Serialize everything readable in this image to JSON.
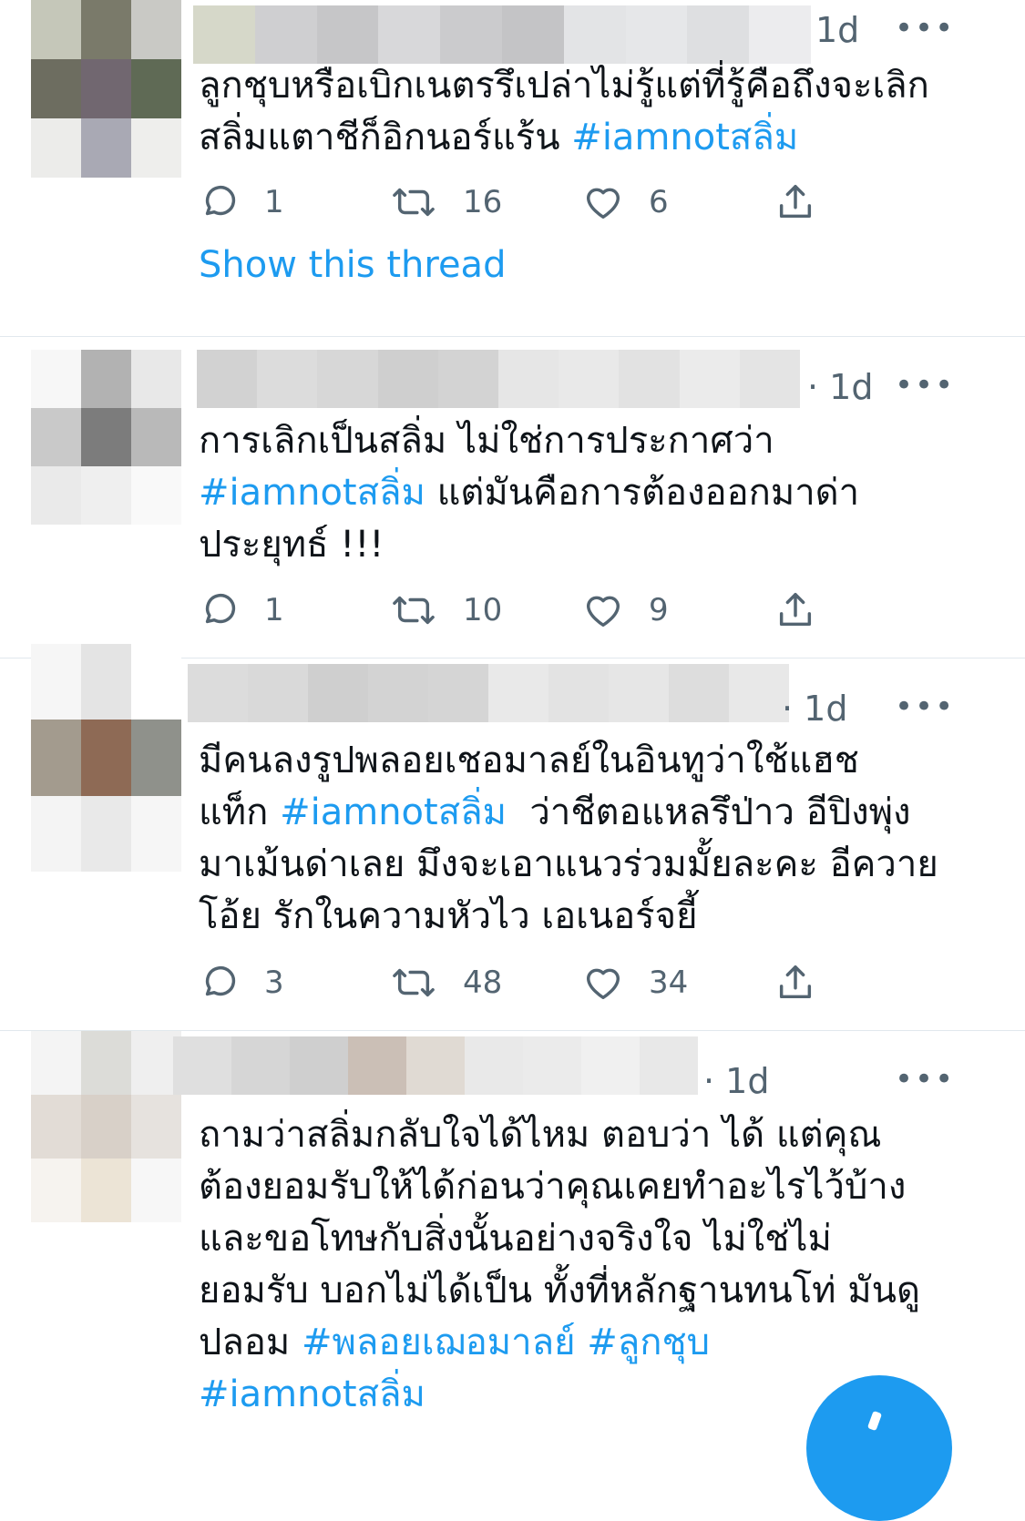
{
  "tweets": [
    {
      "time": "1d",
      "lines": [
        [
          {
            "t": "ลูกชุบหรือเบิกเนตรรึเปล่าไม่รู้แต่ที่รู้คือถึงจะเลิก"
          }
        ],
        [
          {
            "t": "สลิ่มแตาชีก็อิกนอร์แร้น "
          },
          {
            "t": "#iamnotสลิ่ม",
            "hashtag": true
          }
        ]
      ],
      "replies": "1",
      "retweets": "16",
      "likes": "6",
      "show_thread": "Show this thread"
    },
    {
      "time": "· 1d",
      "lines": [
        [
          {
            "t": "การเลิกเป็นสลิ่ม ไม่ใช่การประกาศว่า"
          }
        ],
        [
          {
            "t": "#iamnotสลิ่ม",
            "hashtag": true
          },
          {
            "t": " แต่มันคือการต้องออกมาด่า"
          }
        ],
        [
          {
            "t": "ประยุทธ์ !!!"
          }
        ]
      ],
      "replies": "1",
      "retweets": "10",
      "likes": "9"
    },
    {
      "time": "· 1d",
      "lines": [
        [
          {
            "t": "มีคนลงรูปพลอยเชอมาลย์ในอินทูว่าใช้แฮช"
          }
        ],
        [
          {
            "t": "แท็ก "
          },
          {
            "t": "#iamnotสลิ่ม",
            "hashtag": true
          },
          {
            "t": "  ว่าชีตอแหลรึป่าว อีปิงพุ่ง"
          }
        ],
        [
          {
            "t": "มาเม้นด่าเลย มึงจะเอาแนวร่วมมั้ยละคะ อีควาย"
          }
        ],
        [
          {
            "t": "โอ้ย รักในความหัวไว เอเนอร์จยี้"
          }
        ]
      ],
      "replies": "3",
      "retweets": "48",
      "likes": "34"
    },
    {
      "time": "· 1d",
      "lines": [
        [
          {
            "t": "ถามว่าสลิ่มกลับใจได้ไหม ตอบว่า ได้ แต่คุณ"
          }
        ],
        [
          {
            "t": "ต้องยอมรับให้ได้ก่อนว่าคุณเคยทำอะไรไว้บ้าง"
          }
        ],
        [
          {
            "t": "และขอโทษกับสิ่งนั้นอย่างจริงใจ ไม่ใช่ไม่"
          }
        ],
        [
          {
            "t": "ยอมรับ บอกไม่ได้เป็น ทั้งที่หลักฐานทนโท่ มันดู"
          }
        ],
        [
          {
            "t": "ปลอม "
          },
          {
            "t": "#พลอยเฌอมาลย์",
            "hashtag": true
          },
          {
            "t": " "
          },
          {
            "t": "#ลูกชุบ",
            "hashtag": true
          }
        ],
        [
          {
            "t": "#iamnotสลิ่ม",
            "hashtag": true
          }
        ]
      ]
    }
  ],
  "more_icon": "more-horizontal-icon",
  "colors": {
    "accent": "#1d9bf0",
    "secondary_text": "#536471",
    "divider": "#e1e8ed"
  }
}
